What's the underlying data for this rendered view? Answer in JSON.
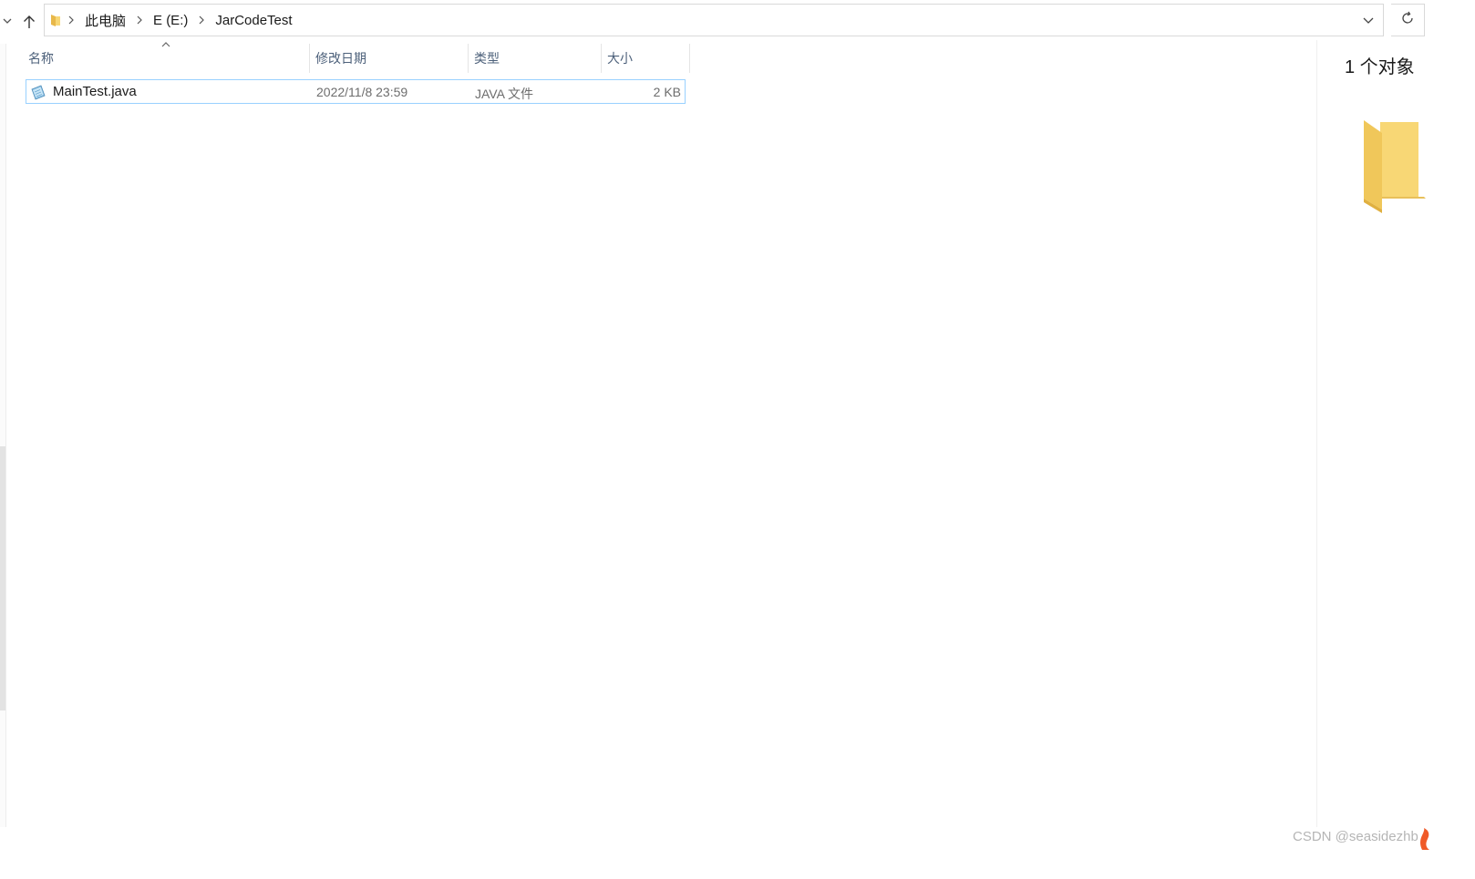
{
  "address_bar": {
    "breadcrumbs": [
      "此电脑",
      "E (E:)",
      "JarCodeTest"
    ]
  },
  "columns": {
    "name": "名称",
    "date": "修改日期",
    "type": "类型",
    "size": "大小"
  },
  "files": [
    {
      "name": "MainTest.java",
      "modified": "2022/11/8 23:59",
      "type": "JAVA 文件",
      "size": "2 KB"
    }
  ],
  "details": {
    "count": "1 个对象"
  },
  "watermark": "CSDN @seasidezhb",
  "icons": {
    "nav": [
      "chevron-down-icon",
      "arrow-up-icon"
    ],
    "address": [
      "folder-icon",
      "chevron-right-icon",
      "chevron-down-icon",
      "refresh-icon"
    ],
    "file": "java-file-icon",
    "details": "large-folder-icon"
  },
  "colors": {
    "accent_border": "#99d1ff",
    "header_text": "#4c607a",
    "secondary_text": "#6d6d6d",
    "folder_yellow": "#f8d775"
  }
}
